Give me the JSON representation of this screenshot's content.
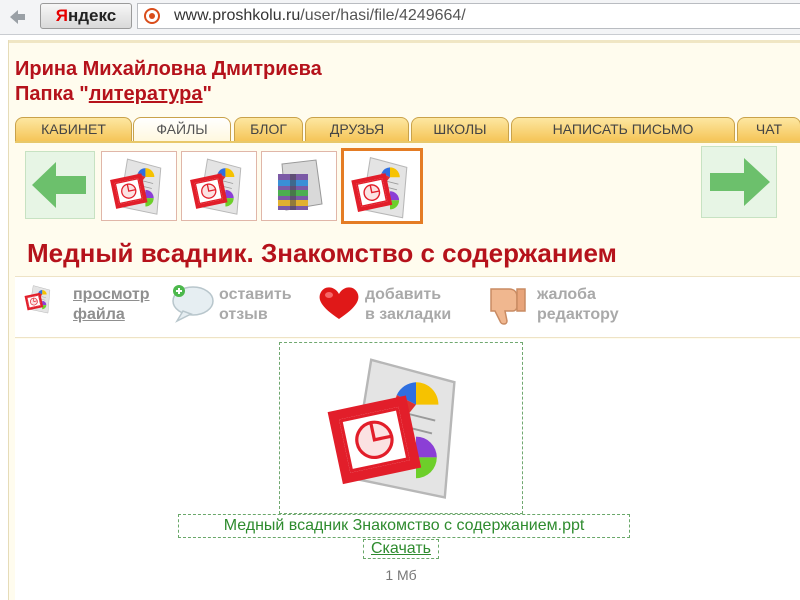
{
  "browser": {
    "search_button_first": "Я",
    "search_button_rest": "ндекс",
    "url_domain": "www.proshkolu.ru",
    "url_path": "/user/hasi/file/4249664/"
  },
  "profile": {
    "user_name": "Ирина Михайловна Дмитриева",
    "folder_prefix": "Папка \"",
    "folder_name": "литература",
    "folder_suffix": "\""
  },
  "tabs": [
    {
      "label": "КАБИНЕТ"
    },
    {
      "label": "ФАЙЛЫ"
    },
    {
      "label": "БЛОГ"
    },
    {
      "label": "ДРУЗЬЯ"
    },
    {
      "label": "ШКОЛЫ"
    },
    {
      "label": "НАПИСАТЬ ПИСЬМО"
    },
    {
      "label": "ЧАТ"
    }
  ],
  "active_tab": "ФАЙЛЫ",
  "file": {
    "title": "Медный всадник. Знакомство с содержанием",
    "file_name": "Медный всадник Знакомство с содержанием.ppt",
    "download_label": "Скачать",
    "size": "1 Мб"
  },
  "actions": [
    {
      "label": "просмотр\nфайла",
      "icon": "ppt-icon"
    },
    {
      "label": "оставить\nотзыв",
      "icon": "comment-bubble-icon"
    },
    {
      "label": "добавить\nв закладки",
      "icon": "heart-icon"
    },
    {
      "label": "жалоба\nредактору",
      "icon": "thumbs-down-icon"
    }
  ],
  "colors": {
    "accent_red": "#b5121b",
    "tab_gold": "#f5c558",
    "selected_orange": "#e47c24",
    "link_green": "#2e8b2e",
    "arrow_green": "#6cc06c"
  }
}
